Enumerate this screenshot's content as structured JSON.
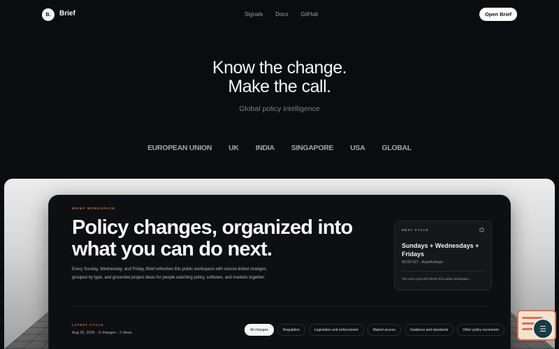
{
  "header": {
    "logo_mark": "B.",
    "brand": "Brief",
    "nav": [
      "Signals",
      "Docs",
      "GitHub"
    ],
    "cta": "Open Brief"
  },
  "hero": {
    "title_line1": "Know the change.",
    "title_line2": "Make the call.",
    "subtitle": "Global policy intelligence",
    "regions": [
      "EUROPEAN UNION",
      "UK",
      "INDIA",
      "SINGAPORE",
      "USA",
      "GLOBAL"
    ]
  },
  "workspace": {
    "eyebrow": "BRIEF WORKSPACE",
    "title": "Policy changes, organized into what you can do next.",
    "description": "Every Sunday, Wednesday, and Friday, Brief refreshes this public workspace with source-linked changes, grouped by type, and grounded project ideas for people watching policy, software, and markets together.",
    "next_cycle": {
      "eyebrow": "NEXT CYCLE",
      "title": "Sundays + Wednesdays + Fridays",
      "time": "06:00 IST · Asia/Kolkata",
      "note": "The next cycle will refresh this public workspace."
    },
    "latest": {
      "eyebrow": "LATEST CYCLE",
      "meta": "Aug 25, 2026 · 3 changes · 2 ideas"
    },
    "filters": [
      "All changes",
      "Regulation",
      "Legislation and enforcement",
      "Market access",
      "Guidance and standards",
      "Other policy movement"
    ],
    "active_filter": "All changes"
  },
  "colors": {
    "accent": "#e0704a",
    "background": "#0b0c0f",
    "panel": "#0e0f12"
  }
}
